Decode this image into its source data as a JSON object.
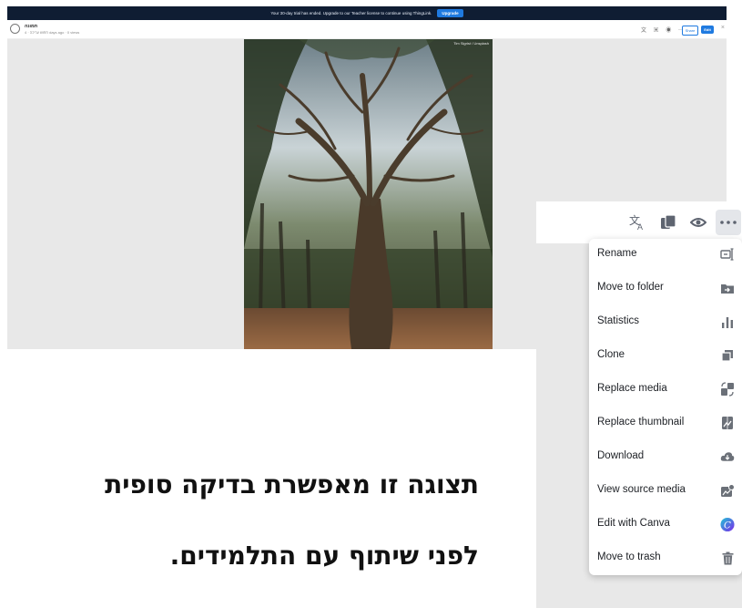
{
  "banner": {
    "text": "Your 30-day trial has ended. Upgrade to our Teacher license to continue using ThingLink.",
    "upgrade_label": "Upgrade"
  },
  "header": {
    "title": "תמונה",
    "meta": "חפוש עריכה · 4 days ago · 0 views",
    "share_label": "Share",
    "edit_label": "Edit"
  },
  "photo": {
    "credit": "Tim Sigrist / Unsplash"
  },
  "toolbar": {
    "icons": [
      "translate-icon",
      "copy-icon",
      "eye-icon",
      "more-icon"
    ]
  },
  "menu": {
    "items": [
      {
        "label": "Rename",
        "icon": "rename-icon"
      },
      {
        "label": "Move to folder",
        "icon": "folder-move-icon"
      },
      {
        "label": "Statistics",
        "icon": "statistics-icon"
      },
      {
        "label": "Clone",
        "icon": "clone-icon"
      },
      {
        "label": "Replace media",
        "icon": "replace-media-icon"
      },
      {
        "label": "Replace thumbnail",
        "icon": "replace-thumbnail-icon"
      },
      {
        "label": "Download",
        "icon": "download-cloud-icon"
      },
      {
        "label": "View source media",
        "icon": "view-source-icon"
      },
      {
        "label": "Edit with Canva",
        "icon": "canva-icon"
      },
      {
        "label": "Move to trash",
        "icon": "trash-icon"
      }
    ]
  },
  "caption": {
    "line1": "תצוגה זו מאפשרת בדיקה סופית",
    "line2": "לפני שיתוף עם התלמידים."
  },
  "colors": {
    "accent": "#1f7ae0",
    "banner_bg": "#0f1d33",
    "canva": "#7d2ae8"
  }
}
